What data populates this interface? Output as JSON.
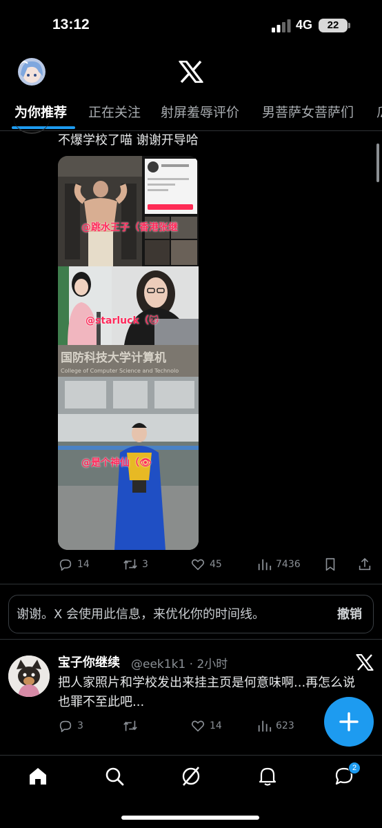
{
  "status_bar": {
    "time": "13:12",
    "network": "4G",
    "battery": "22"
  },
  "header": {
    "logo_icon": "x-logo-icon",
    "avatar_icon": "anime-avatar"
  },
  "tabs": [
    {
      "label": "为你推荐",
      "active": true
    },
    {
      "label": "正在关注",
      "active": false
    },
    {
      "label": "射屏羞辱评价",
      "active": false
    },
    {
      "label": "男菩萨女菩萨们",
      "active": false
    },
    {
      "label": "瓜",
      "active": false
    }
  ],
  "tweet1": {
    "text": "不爆学校了喵 谢谢开导哈",
    "media_labels": [
      "@跳水王子（香港张继",
      "@starluck（🐱",
      "国防科技大学计算机",
      "College of Computer Science and Technolo",
      "@是个神仙（👁"
    ],
    "actions": {
      "replies": "14",
      "retweets": "3",
      "likes": "45",
      "views": "7436"
    }
  },
  "feedback": {
    "text": "谢谢。X 会使用此信息，来优化你的时间线。",
    "undo": "撤销"
  },
  "tweet2": {
    "name": "宝子你继续",
    "handle": "@eek1k1 · 2小时",
    "text": "把人家照片和学校发出来挂主页是何意味啊...再怎么说也罪不至此吧...",
    "actions": {
      "replies": "3",
      "retweets": "",
      "likes": "14",
      "views": "623"
    }
  },
  "bottom_nav": {
    "items": [
      "home-icon",
      "search-icon",
      "grok-icon",
      "notifications-icon",
      "messages-icon"
    ],
    "messages_badge": "2"
  },
  "colors": {
    "accent": "#1d9bf0",
    "background": "#000000"
  }
}
